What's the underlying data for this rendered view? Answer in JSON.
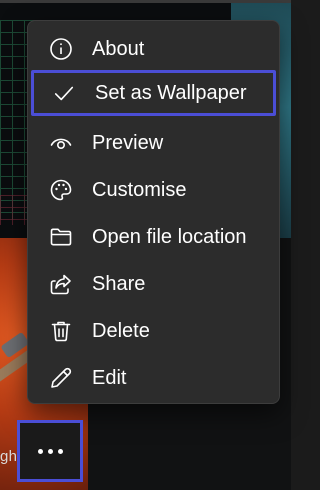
{
  "menu": {
    "items": [
      {
        "label": "About",
        "icon": "info-icon"
      },
      {
        "label": "Set as Wallpaper",
        "icon": "checkmark-icon",
        "highlighted": true
      },
      {
        "label": "Preview",
        "icon": "eye-icon"
      },
      {
        "label": "Customise",
        "icon": "palette-icon"
      },
      {
        "label": "Open file location",
        "icon": "folder-icon"
      },
      {
        "label": "Share",
        "icon": "share-icon"
      },
      {
        "label": "Delete",
        "icon": "trash-icon"
      },
      {
        "label": "Edit",
        "icon": "pencil-icon"
      }
    ]
  },
  "thumbnail": {
    "caption": "ght"
  },
  "more_button": {
    "icon": "more-icon"
  },
  "colors": {
    "menu_background": "#2c2c2c",
    "highlight_border": "#4b4ed6",
    "text": "#ffffff"
  }
}
